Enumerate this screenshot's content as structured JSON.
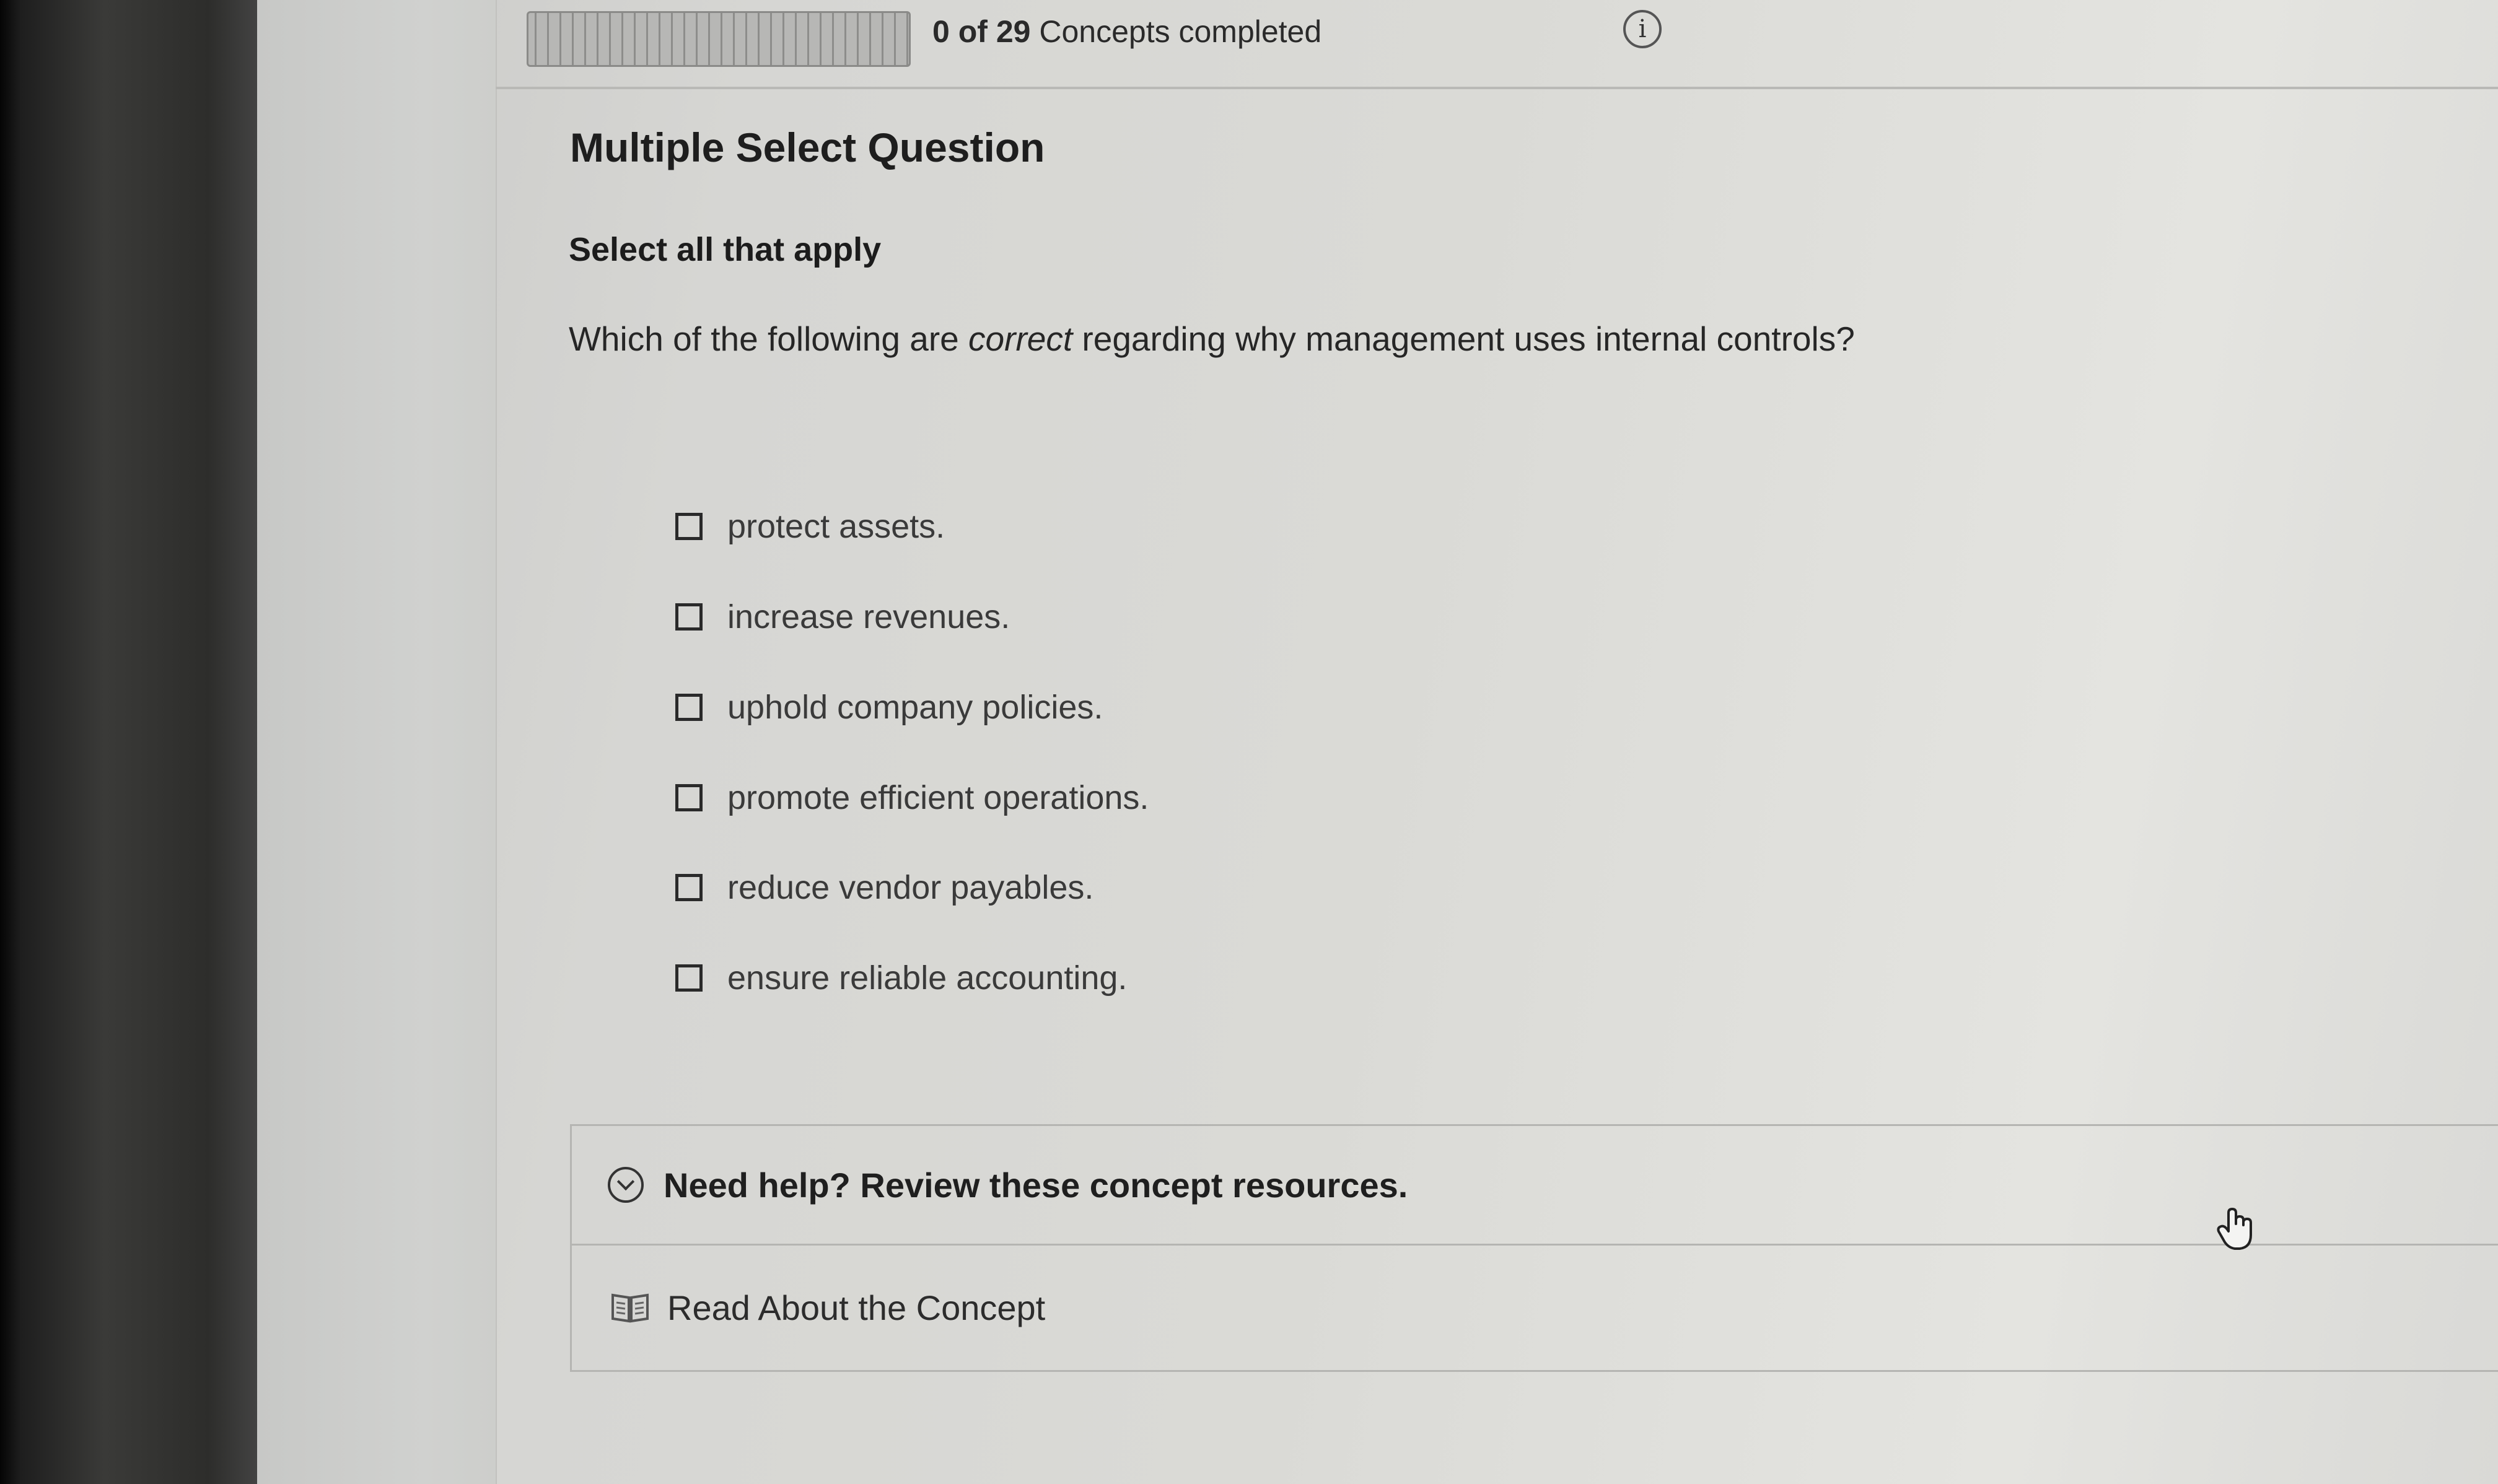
{
  "progress": {
    "completed": "0",
    "total": "29",
    "of_word": "of",
    "suffix": "Concepts completed",
    "fraction": 0
  },
  "info_icon": "info-icon",
  "question": {
    "type_label": "Multiple Select Question",
    "instruction": "Select all that apply",
    "text_before": "Which of the following are ",
    "text_emphasis": "correct",
    "text_after": " regarding why management uses internal controls?"
  },
  "options": [
    {
      "label": "protect assets.",
      "checked": false
    },
    {
      "label": "increase revenues.",
      "checked": false
    },
    {
      "label": "uphold company policies.",
      "checked": false
    },
    {
      "label": "promote efficient operations.",
      "checked": false
    },
    {
      "label": "reduce vendor payables.",
      "checked": false
    },
    {
      "label": "ensure reliable accounting.",
      "checked": false
    }
  ],
  "help": {
    "title": "Need help? Review these concept resources.",
    "icon": "chevron-down-icon",
    "read_label": "Read About the Concept",
    "read_icon": "book-icon"
  },
  "colors": {
    "progress_fill": "#2f6fb7",
    "text": "#1e1e1e"
  }
}
